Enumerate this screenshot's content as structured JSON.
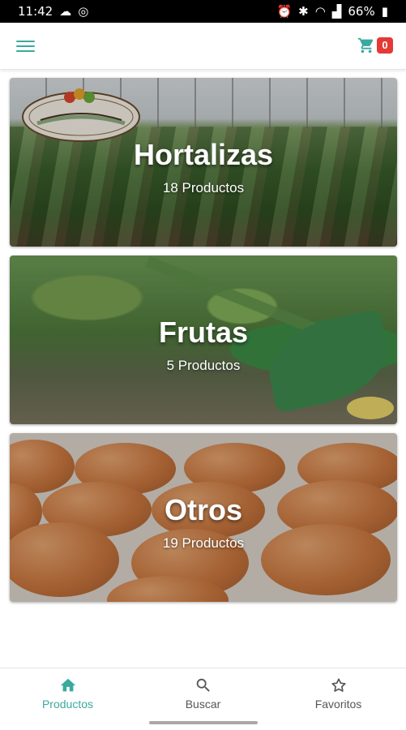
{
  "status_bar": {
    "time": "11:42",
    "battery": "66%"
  },
  "header": {
    "cart_count": "0"
  },
  "categories": [
    {
      "title": "Hortalizas",
      "count": "18 Productos"
    },
    {
      "title": "Frutas",
      "count": "5 Productos"
    },
    {
      "title": "Otros",
      "count": "19 Productos"
    }
  ],
  "bottom_nav": {
    "items": [
      {
        "label": "Productos",
        "icon": "home-icon",
        "active": true
      },
      {
        "label": "Buscar",
        "icon": "search-icon",
        "active": false
      },
      {
        "label": "Favoritos",
        "icon": "star-icon",
        "active": false
      }
    ]
  },
  "colors": {
    "accent": "#3aa99f",
    "badge": "#e53935"
  }
}
